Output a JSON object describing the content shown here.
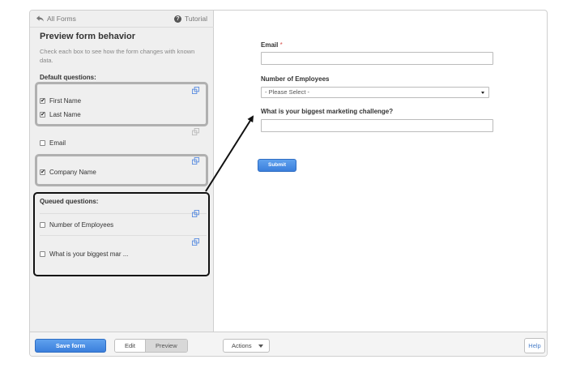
{
  "nav": {
    "back_label": "All Forms",
    "tutorial_label": "Tutorial"
  },
  "panel": {
    "title": "Preview form behavior",
    "help_text": "Check each box to see how the form changes with known data.",
    "default_label": "Default questions:",
    "queued_label": "Queued questions:"
  },
  "questions": {
    "first_name": {
      "label": "First Name",
      "checked": true
    },
    "last_name": {
      "label": "Last Name",
      "checked": true
    },
    "email": {
      "label": "Email",
      "checked": false
    },
    "company_name": {
      "label": "Company Name",
      "checked": true
    },
    "employees": {
      "label": "Number of Employees",
      "checked": false
    },
    "challenge": {
      "label": "What is your biggest mar ...",
      "checked": false
    }
  },
  "form": {
    "email_label": "Email",
    "required_mark": "*",
    "employees_label": "Number of Employees",
    "employees_selected": "- Please Select -",
    "challenge_label": "What is your biggest marketing challenge?",
    "submit_label": "Submit"
  },
  "toolbar": {
    "save_label": "Save form",
    "edit_label": "Edit",
    "preview_label": "Preview",
    "actions_label": "Actions",
    "help_label": "Help"
  },
  "colors": {
    "primary_button": "#3b7fdc",
    "highlight_grey": "#b0b0b0",
    "highlight_black": "#111111",
    "required": "#d9534f"
  }
}
